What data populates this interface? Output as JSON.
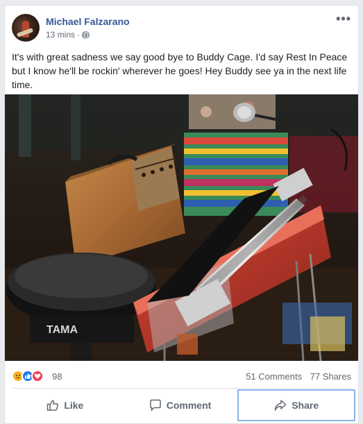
{
  "post": {
    "author": "Michael Falzarano",
    "timestamp": "13 mins",
    "separator": "·",
    "privacy_icon": "globe-icon",
    "more_icon": "more-options-icon",
    "more_label": "•••",
    "text": "It's with great sadness we say good bye to Buddy Cage. I'd say Rest In Peace but I know he'll be rockin' wherever he goes! Hey Buddy see ya in the next life time."
  },
  "photo": {
    "brand_label": "TAMA"
  },
  "stats": {
    "reaction_icons": [
      "sad-reaction-icon",
      "like-reaction-icon",
      "love-reaction-icon"
    ],
    "reaction_count": "98",
    "comments": "51 Comments",
    "shares": "77 Shares"
  },
  "actions": {
    "like_label": "Like",
    "comment_label": "Comment",
    "share_label": "Share"
  },
  "colors": {
    "author_link": "#385898",
    "like_blue": "#1877f2",
    "love_red": "#f33e58",
    "sad_yellow": "#f7b125",
    "focus_outline": "#8ab2e8"
  }
}
